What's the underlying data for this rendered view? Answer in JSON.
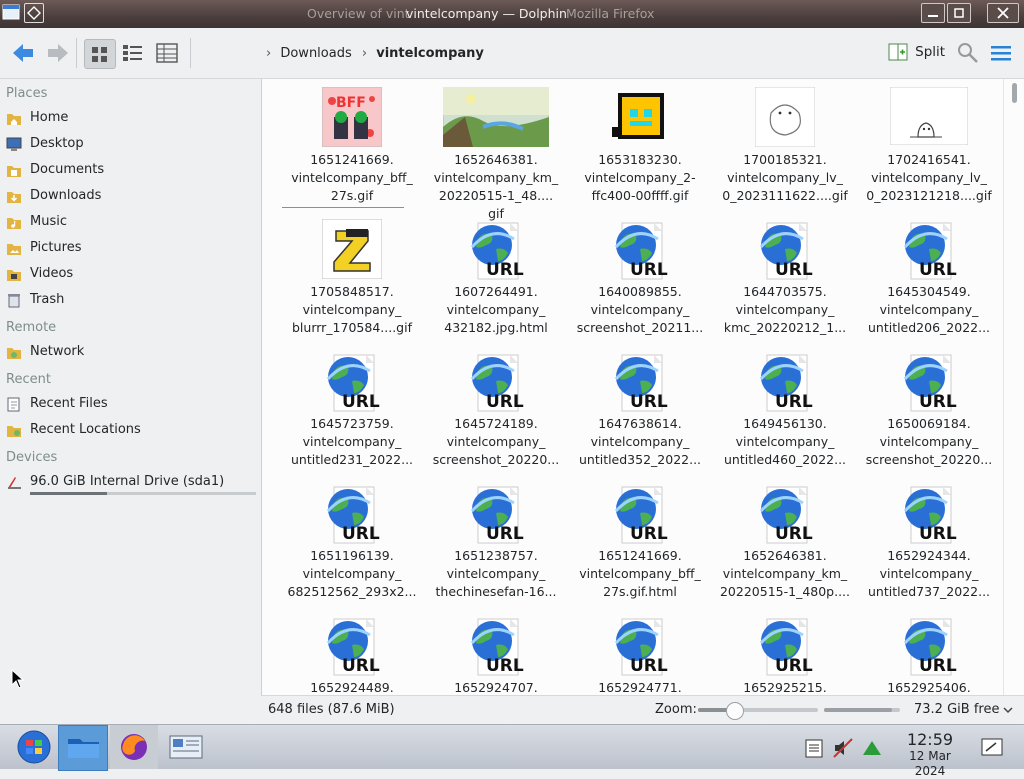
{
  "window": {
    "ghost_title_left": "Overview of vint",
    "ghost_title_right": "Mozilla Firefox",
    "title": "vintelcompany — Dolphin"
  },
  "toolbar": {
    "breadcrumb_parent": "Downloads",
    "breadcrumb_current": "vintelcompany",
    "split_label": "Split"
  },
  "sidebar": {
    "places_header": "Places",
    "places": [
      "Home",
      "Desktop",
      "Documents",
      "Downloads",
      "Music",
      "Pictures",
      "Videos",
      "Trash"
    ],
    "remote_header": "Remote",
    "remote": [
      "Network"
    ],
    "recent_header": "Recent",
    "recent": [
      "Recent Files",
      "Recent Locations"
    ],
    "devices_header": "Devices",
    "devices": [
      "96.0 GiB Internal Drive (sda1)"
    ]
  },
  "files": [
    {
      "l1": "1651241669.",
      "l2": "vintelcompany_bff_",
      "l3": "27s.gif",
      "icon": "bff-thumbnail"
    },
    {
      "l1": "1652646381.",
      "l2": "vintelcompany_km_",
      "l3": "20220515-1_48....",
      "l4": "gif",
      "icon": "landscape-thumbnail"
    },
    {
      "l1": "1653183230.",
      "l2": "vintelcompany_2-",
      "l3": "ffc400-00ffff.gif",
      "icon": "yellow-cube-thumbnail"
    },
    {
      "l1": "1700185321.",
      "l2": "vintelcompany_lv_",
      "l3": "0_2023111622....gif",
      "icon": "sketch-thumbnail"
    },
    {
      "l1": "1702416541.",
      "l2": "vintelcompany_lv_",
      "l3": "0_2023121218....gif",
      "icon": "blob-thumbnail"
    },
    {
      "l1": "1705848517.",
      "l2": "vintelcompany_",
      "l3": "blurrr_170584....gif",
      "icon": "letter-z-thumbnail"
    },
    {
      "l1": "1607264491.",
      "l2": "vintelcompany_",
      "l3": "432182.jpg.html",
      "icon": "url-icon"
    },
    {
      "l1": "1640089855.",
      "l2": "vintelcompany_",
      "l3": "screenshot_20211...",
      "icon": "url-icon"
    },
    {
      "l1": "1644703575.",
      "l2": "vintelcompany_",
      "l3": "kmc_20220212_1...",
      "icon": "url-icon"
    },
    {
      "l1": "1645304549.",
      "l2": "vintelcompany_",
      "l3": "untitled206_2022...",
      "icon": "url-icon"
    },
    {
      "l1": "1645723759.",
      "l2": "vintelcompany_",
      "l3": "untitled231_2022...",
      "icon": "url-icon"
    },
    {
      "l1": "1645724189.",
      "l2": "vintelcompany_",
      "l3": "screenshot_20220...",
      "icon": "url-icon"
    },
    {
      "l1": "1647638614.",
      "l2": "vintelcompany_",
      "l3": "untitled352_2022...",
      "icon": "url-icon"
    },
    {
      "l1": "1649456130.",
      "l2": "vintelcompany_",
      "l3": "untitled460_2022...",
      "icon": "url-icon"
    },
    {
      "l1": "1650069184.",
      "l2": "vintelcompany_",
      "l3": "screenshot_20220...",
      "icon": "url-icon"
    },
    {
      "l1": "1651196139.",
      "l2": "vintelcompany_",
      "l3": "682512562_293x2...",
      "icon": "url-icon"
    },
    {
      "l1": "1651238757.",
      "l2": "vintelcompany_",
      "l3": "thechinesefan-16...",
      "icon": "url-icon"
    },
    {
      "l1": "1651241669.",
      "l2": "vintelcompany_bff_",
      "l3": "27s.gif.html",
      "icon": "url-icon"
    },
    {
      "l1": "1652646381.",
      "l2": "vintelcompany_km_",
      "l3": "20220515-1_480p....",
      "icon": "url-icon"
    },
    {
      "l1": "1652924344.",
      "l2": "vintelcompany_",
      "l3": "untitled737_2022...",
      "icon": "url-icon"
    },
    {
      "l1": "1652924489.",
      "icon": "url-icon"
    },
    {
      "l1": "1652924707.",
      "icon": "url-icon"
    },
    {
      "l1": "1652924771.",
      "icon": "url-icon"
    },
    {
      "l1": "1652925215.",
      "icon": "url-icon"
    },
    {
      "l1": "1652925406.",
      "icon": "url-icon"
    }
  ],
  "url_badge": "URL",
  "status": {
    "file_count": "648 files (87.6 MiB)",
    "zoom_label": "Zoom:",
    "zoom_level": 0.3,
    "free_space": "73.2 GiB free",
    "free_fraction": 0.9
  },
  "taskbar": {
    "time": "12:59",
    "date": "12 Mar 2024"
  },
  "colors": {
    "accent": "#3daee9",
    "url_text": "#111111",
    "globe_blue": "#2a6fd6",
    "globe_green": "#4caf50"
  }
}
